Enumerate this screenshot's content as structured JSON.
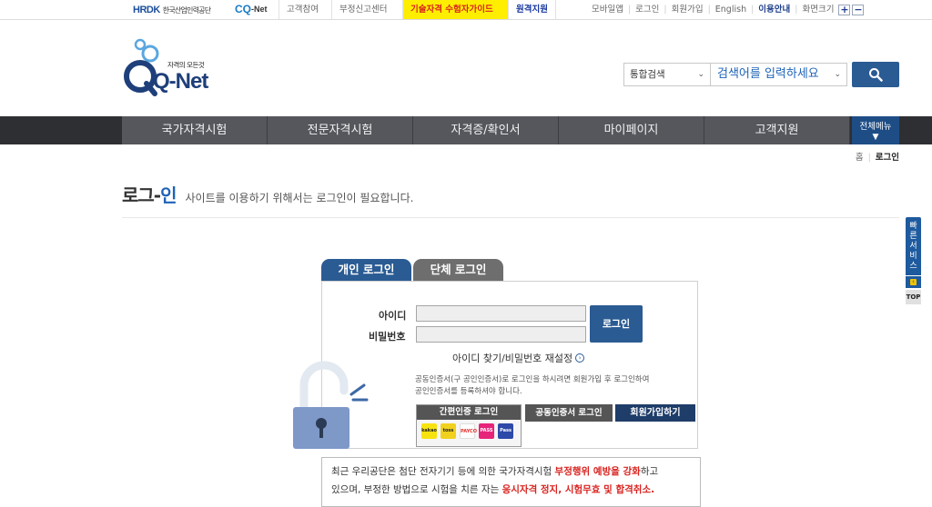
{
  "topbar": {
    "hrdk_logo": "HRDK",
    "hrdk_sub": "한국산업인력공단",
    "cqnet_logo_cq": "CQ",
    "cqnet_logo_net": "-Net",
    "links": [
      "고객참여",
      "부정신고센터",
      "기술자격 수험자가이드",
      "원격지원"
    ],
    "right_links": [
      "모바일앱",
      "로그인",
      "회원가입",
      "English",
      "이용안내",
      "화면크기"
    ],
    "zoom_in": "+",
    "zoom_out": "−"
  },
  "header": {
    "logo_slogan": "자격의 모든것",
    "logo_text": "Q-Net",
    "search_scope": "통합검색",
    "search_placeholder": "검색어를 입력하세요"
  },
  "gnb": {
    "items": [
      "국가자격시험",
      "전문자격시험",
      "자격증/확인서",
      "마이페이지",
      "고객지원"
    ],
    "all_menu": "전체메뉴"
  },
  "breadcrumb": {
    "home": "홈",
    "current": "로그인"
  },
  "page": {
    "title_a": "로그-",
    "title_b": "인",
    "desc": "사이트를 이용하기 위해서는 로그인이 필요합니다."
  },
  "quick": {
    "label": "빠른서비스",
    "top": "TOP"
  },
  "tabs": [
    "개인 로그인",
    "단체 로그인"
  ],
  "login": {
    "id_label": "아이디",
    "pw_label": "비밀번호",
    "login_button": "로그인",
    "find_link": "아이디 찾기/비밀번호 재설정",
    "notice_line1": "공동인증서(구 공인인증서)로 로그인을 하시려면 회원가입 후 로그인하여",
    "notice_line2": "공인인증서를 등록하셔야 합니다.",
    "simple_cert": "간편인증 로그인",
    "joint_cert": "공동인증서 로그인",
    "join": "회원가입하기",
    "cert_icons": [
      {
        "name": "kakao",
        "label": "kakao",
        "color": "#f7e30f"
      },
      {
        "name": "toss",
        "label": "toss",
        "color": "#f1d11d"
      },
      {
        "name": "payco",
        "label": "PAYCO",
        "color": "#ffffff"
      },
      {
        "name": "pass",
        "label": "PASS",
        "color": "#e6247a"
      },
      {
        "name": "naver",
        "label": "Pass",
        "color": "#2d4aa8"
      }
    ]
  },
  "warning": {
    "line1_a": "최근 우리공단은 첨단 전자기기 등에 의한 국가자격시험 ",
    "line1_red": "부정행위 예방을 강화",
    "line1_b": "하고",
    "line2_a": "있으며, 부정한 방법으로 시험을 치른 자는 ",
    "line2_red": "응시자격 정지, 시험무효 및 합격취소."
  }
}
